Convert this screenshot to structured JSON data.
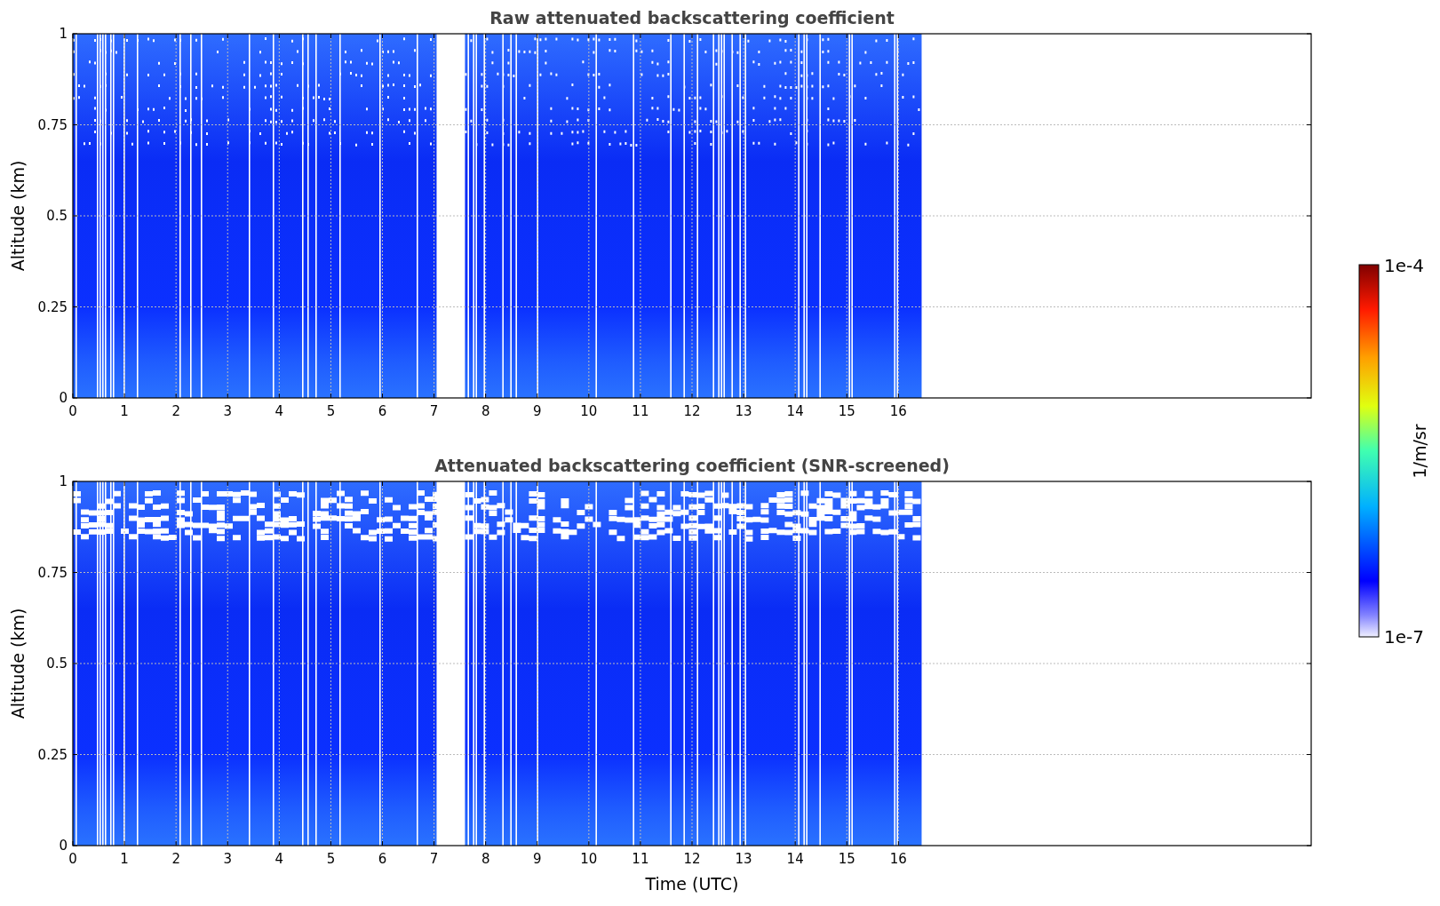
{
  "panels": [
    {
      "title": "Raw attenuated backscattering coefficient",
      "ylabel": "Altitude (km)",
      "yticks": [
        "1",
        "0.75",
        "0.5",
        "0.25",
        "0"
      ],
      "xticks": [
        "0",
        "1",
        "2",
        "3",
        "4",
        "5",
        "6",
        "7",
        "8",
        "9",
        "10",
        "11",
        "12",
        "13",
        "14",
        "15",
        "16"
      ]
    },
    {
      "title": "Attenuated backscattering coefficient (SNR-screened)",
      "ylabel": "Altitude (km)",
      "yticks": [
        "1",
        "0.75",
        "0.5",
        "0.25",
        "0"
      ],
      "xticks": [
        "0",
        "1",
        "2",
        "3",
        "4",
        "5",
        "6",
        "7",
        "8",
        "9",
        "10",
        "11",
        "12",
        "13",
        "14",
        "15",
        "16"
      ],
      "xlabel": "Time (UTC)"
    }
  ],
  "colorbar": {
    "label": "1/m/sr",
    "max_label": "1e-4",
    "min_label": "1e-7"
  }
}
